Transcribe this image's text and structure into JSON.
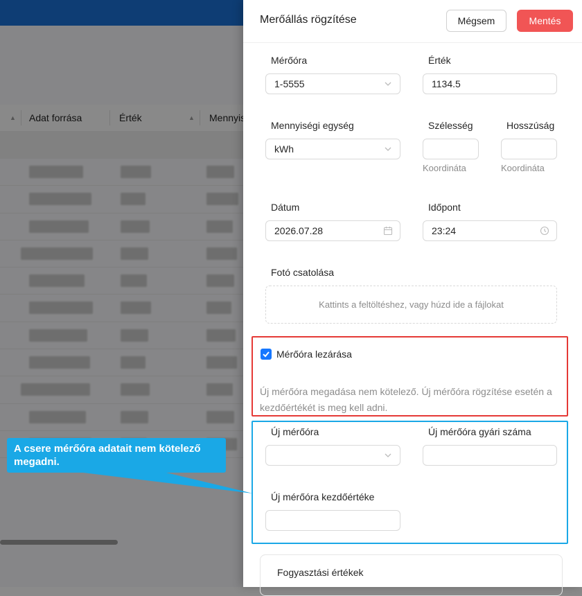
{
  "background_table": {
    "columns": [
      "Adat forrása",
      "Érték",
      "Mennyis"
    ]
  },
  "drawer": {
    "title": "Merőállás rögzítése",
    "cancel_label": "Mégsem",
    "save_label": "Mentés",
    "meter_label": "Mérőóra",
    "meter_value": "1-5555",
    "value_label": "Érték",
    "value_value": "1134.5",
    "unit_label": "Mennyiségi egység",
    "unit_value": "kWh",
    "lat_label": "Szélesség",
    "lon_label": "Hosszúság",
    "coord_hint": "Koordináta",
    "date_label": "Dátum",
    "date_value": "2026.07.28",
    "time_label": "Időpont",
    "time_value": "23:24",
    "photo_label": "Fotó csatolása",
    "upload_text": "Kattints a feltöltéshez, vagy húzd ide a fájlokat",
    "close_meter_label": "Mérőóra lezárása",
    "close_meter_checked": true,
    "close_note": "Új mérőóra megadása nem kötelező. Új mérőóra rögzítése esetén a kezdőértékét is meg kell adni.",
    "new_meter_label": "Új mérőóra",
    "new_meter_serial_label": "Új mérőóra gyári száma",
    "new_meter_start_label": "Új mérőóra kezdőértéke",
    "consumption_title": "Fogyasztási értékek"
  },
  "callout": {
    "text": "A csere mérőóra adatait nem kötelező megadni."
  },
  "colors": {
    "primary": "#1677ff",
    "danger_button": "#f15555",
    "highlight_red": "#e53935",
    "highlight_blue": "#1aa8e6"
  }
}
